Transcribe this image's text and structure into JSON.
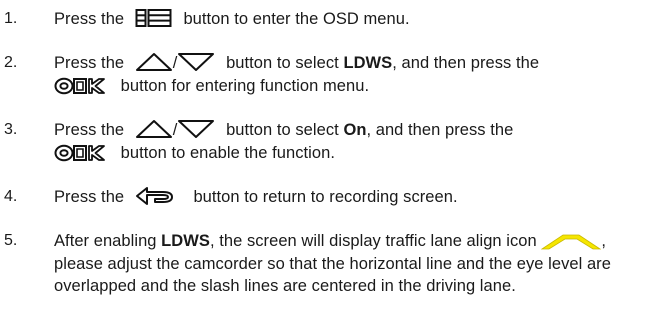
{
  "steps": [
    {
      "number": "1.",
      "press": "Press the",
      "after_icon": "button to enter the OSD menu.",
      "icon": "menu-icon"
    },
    {
      "number": "2.",
      "press": "Press the",
      "slash": "/",
      "mid": "button to select",
      "bold": "LDWS",
      "tail": ", and then press the",
      "after_ok": "button for entering function menu.",
      "icons": [
        "up-arrow-icon",
        "down-arrow-icon",
        "ok-icon"
      ]
    },
    {
      "number": "3.",
      "press": "Press the",
      "slash": "/",
      "mid": "button to select",
      "bold": "On",
      "tail": ", and then press the",
      "after_ok": "button to enable the function.",
      "icons": [
        "up-arrow-icon",
        "down-arrow-icon",
        "ok-icon"
      ]
    },
    {
      "number": "4.",
      "press": "Press the",
      "after_icon": "button to return to recording screen.",
      "icon": "return-icon"
    },
    {
      "number": "5.",
      "lead": "After enabling",
      "bold": "LDWS",
      "rest": ", the screen will display traffic lane align icon",
      "after_icon": ", please adjust the camcorder so that the horizontal line and the eye level are overlapped and the slash lines are centered in the driving lane.",
      "icon": "lane-align-icon",
      "icon_color": "#f5e600"
    }
  ]
}
